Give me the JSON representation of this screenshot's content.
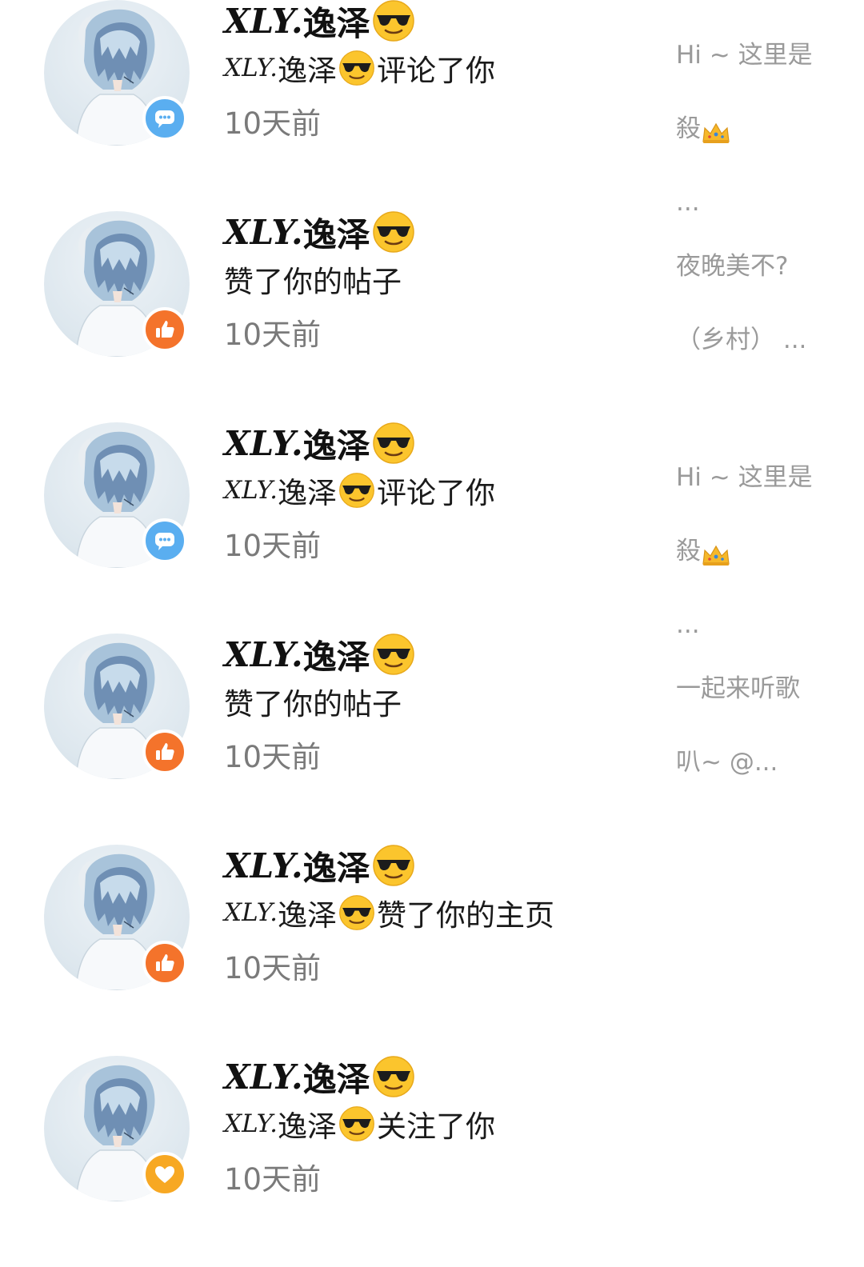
{
  "notifications": [
    {
      "type": "comment",
      "user_name": "𝒳𝓛𝒴.逸泽",
      "name_script": "XLY.",
      "name_cn": "逸泽",
      "action_text": "评论了你",
      "action_prefix_script": "XLY.",
      "action_prefix_cn": "逸泽",
      "time": "10天前",
      "badge_icon": "comment-icon",
      "preview_lines": [
        "Hi ~ 这里是",
        "殺",
        "..."
      ]
    },
    {
      "type": "like",
      "name_script": "XLY.",
      "name_cn": "逸泽",
      "action_text": "赞了你的帖子",
      "time": "10天前",
      "badge_icon": "thumbs-up-icon",
      "preview_lines": [
        "夜晚美不?",
        "（乡村） ..."
      ]
    },
    {
      "type": "comment",
      "name_script": "XLY.",
      "name_cn": "逸泽",
      "action_text": "评论了你",
      "action_prefix_script": "XLY.",
      "action_prefix_cn": "逸泽",
      "time": "10天前",
      "badge_icon": "comment-icon",
      "preview_lines": [
        "Hi ~ 这里是",
        "殺",
        "..."
      ]
    },
    {
      "type": "like",
      "name_script": "XLY.",
      "name_cn": "逸泽",
      "action_text": "赞了你的帖子",
      "time": "10天前",
      "badge_icon": "thumbs-up-icon",
      "preview_lines": [
        "一起来听歌",
        "叭~ @..."
      ]
    },
    {
      "type": "like",
      "name_script": "XLY.",
      "name_cn": "逸泽",
      "action_text": "赞了你的主页",
      "action_prefix_script": "XLY.",
      "action_prefix_cn": "逸泽",
      "time": "10天前",
      "badge_icon": "thumbs-up-icon",
      "preview_lines": []
    },
    {
      "type": "follow",
      "name_script": "XLY.",
      "name_cn": "逸泽",
      "action_text": "关注了你",
      "action_prefix_script": "XLY.",
      "action_prefix_cn": "逸泽",
      "time": "10天前",
      "badge_icon": "heart-icon",
      "preview_lines": []
    }
  ],
  "colors": {
    "comment_badge": "#5aaef0",
    "like_badge": "#f4732b",
    "follow_badge": "#f7a823",
    "secondary_text": "#7a7a7a",
    "preview_text": "#9a9a9a"
  },
  "emoji": {
    "name_emoji": "sunglasses-face",
    "preview_emoji": "crown"
  }
}
